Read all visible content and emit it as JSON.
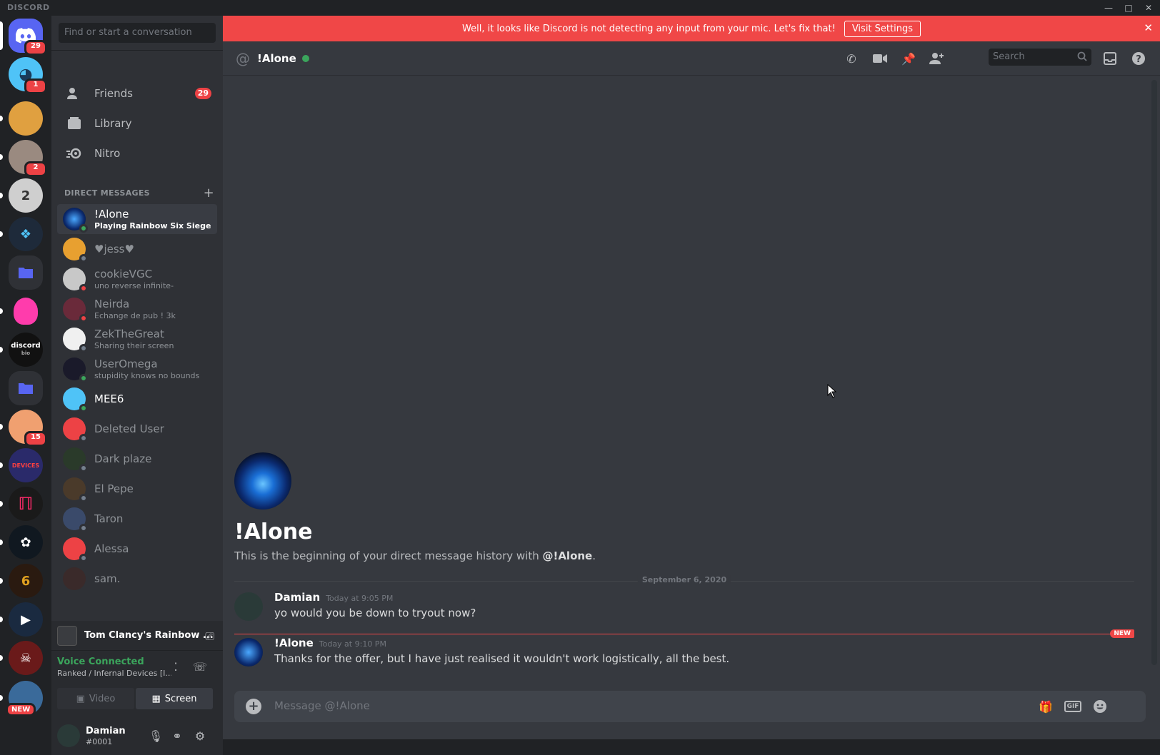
{
  "titlebar": {
    "brand": "DISCORD",
    "minimize_icon": "minimize-icon",
    "maximize_icon": "maximize-icon",
    "close_icon": "close-icon"
  },
  "servers": [
    {
      "name": "home",
      "badge": "29",
      "color": "#5865f2"
    },
    {
      "name": "mee6-server",
      "badge": "1",
      "color": "#4fc3f7"
    },
    {
      "name": "server-3",
      "badge": "",
      "color": "#e0a040"
    },
    {
      "name": "server-4",
      "badge": "2",
      "color": "#9a8a80"
    },
    {
      "name": "server-5",
      "badge": "",
      "color": "#cfcfcf"
    },
    {
      "name": "server-6",
      "badge": "",
      "color": "#1e2a3a"
    },
    {
      "name": "folder-1",
      "badge": "",
      "color": "#2c3a6b"
    },
    {
      "name": "server-8",
      "badge": "",
      "color": "#ff3cac"
    },
    {
      "name": "discord-bio",
      "badge": "",
      "color": "#111"
    },
    {
      "name": "folder-2",
      "badge": "",
      "color": "#2c3a6b"
    },
    {
      "name": "server-11",
      "badge": "15",
      "color": "#f0a070"
    },
    {
      "name": "infernal-devices",
      "badge": "",
      "color": "#2a2a6a"
    },
    {
      "name": "server-13",
      "badge": "",
      "color": "#1a1a1a"
    },
    {
      "name": "server-14",
      "badge": "",
      "color": "#101820"
    },
    {
      "name": "rainbow-six",
      "badge": "",
      "color": "#2a1a10"
    },
    {
      "name": "server-16",
      "badge": "",
      "color": "#1a2a40"
    },
    {
      "name": "server-17",
      "badge": "",
      "color": "#6a1a1a"
    },
    {
      "name": "server-18",
      "badge": "NEW",
      "color": "#3a6a9a"
    }
  ],
  "server_labels": {
    "discord_bio_top": "discord",
    "discord_bio_bottom": "bio",
    "devices": "DEVICES"
  },
  "dm_sidebar": {
    "search_placeholder": "Find or start a conversation",
    "nav": [
      {
        "label": "Friends",
        "icon": "friends-icon",
        "badge": "29"
      },
      {
        "label": "Library",
        "icon": "library-icon",
        "badge": ""
      },
      {
        "label": "Nitro",
        "icon": "nitro-icon",
        "badge": ""
      }
    ],
    "dm_header": "DIRECT MESSAGES",
    "dms": [
      {
        "name": "!Alone",
        "sub": "Playing Rainbow Six Siege",
        "status": "online",
        "avatar_color": "#1a3a8a"
      },
      {
        "name": "♥jess♥",
        "sub": "",
        "status": "offline",
        "avatar_color": "#e8a030"
      },
      {
        "name": "cookieVGC",
        "sub": "uno reverse infinite-",
        "status": "dnd",
        "avatar_color": "#c8c8c8"
      },
      {
        "name": "Neirda",
        "sub": "Echange de pub ! 3k",
        "status": "dnd",
        "avatar_color": "#6a2a3a"
      },
      {
        "name": "ZekTheGreat",
        "sub": "Sharing their screen",
        "status": "offline",
        "avatar_color": "#f0f0f0"
      },
      {
        "name": "UserOmega",
        "sub": "stupidity knows no bounds",
        "status": "online",
        "avatar_color": "#1a1a2a"
      },
      {
        "name": "MEE6",
        "sub": "",
        "status": "online",
        "avatar_color": "#4fc3f7"
      },
      {
        "name": "Deleted User",
        "sub": "",
        "status": "offline",
        "avatar_color": "#ed4245"
      },
      {
        "name": "Dark plaze",
        "sub": "",
        "status": "offline",
        "avatar_color": "#2a3a2a"
      },
      {
        "name": "El Pepe",
        "sub": "",
        "status": "offline",
        "avatar_color": "#4a3a2a"
      },
      {
        "name": "Taron",
        "sub": "",
        "status": "offline",
        "avatar_color": "#3a4a6a"
      },
      {
        "name": "Alessa",
        "sub": "",
        "status": "offline",
        "avatar_color": "#ed4245"
      },
      {
        "name": "sam.",
        "sub": "",
        "status": "offline",
        "avatar_color": "#3a2a2a"
      }
    ],
    "game": {
      "name": "Tom Clancy's Rainbow ..."
    },
    "voice": {
      "status": "Voice Connected",
      "channel": "Ranked / Infernal Devices [I...",
      "video_label": "Video",
      "screen_label": "Screen"
    },
    "user": {
      "name": "Damian",
      "tag": "#0001"
    }
  },
  "notice": {
    "text": "Well, it looks like Discord is not detecting any input from your mic. Let's fix that!",
    "button": "Visit Settings"
  },
  "header": {
    "channel_name": "!Alone",
    "search_placeholder": "Search"
  },
  "welcome": {
    "title": "!Alone",
    "sub_prefix": "This is the beginning of your direct message history with ",
    "sub_user": "@!Alone",
    "sub_suffix": "."
  },
  "date_divider": "September 6, 2020",
  "messages": [
    {
      "author": "Damian",
      "time": "Today at 9:05 PM",
      "text": "yo would you be down to tryout now?"
    },
    {
      "author": "!Alone",
      "time": "Today at 9:10 PM",
      "text": "Thanks for the offer, but I have just realised it wouldn't work logistically, all the best."
    }
  ],
  "new_label": "NEW",
  "composer": {
    "placeholder": "Message @!Alone",
    "gif_label": "GIF"
  },
  "colors": {
    "accent": "#5865f2",
    "danger": "#f04747",
    "online": "#3ba55c"
  }
}
